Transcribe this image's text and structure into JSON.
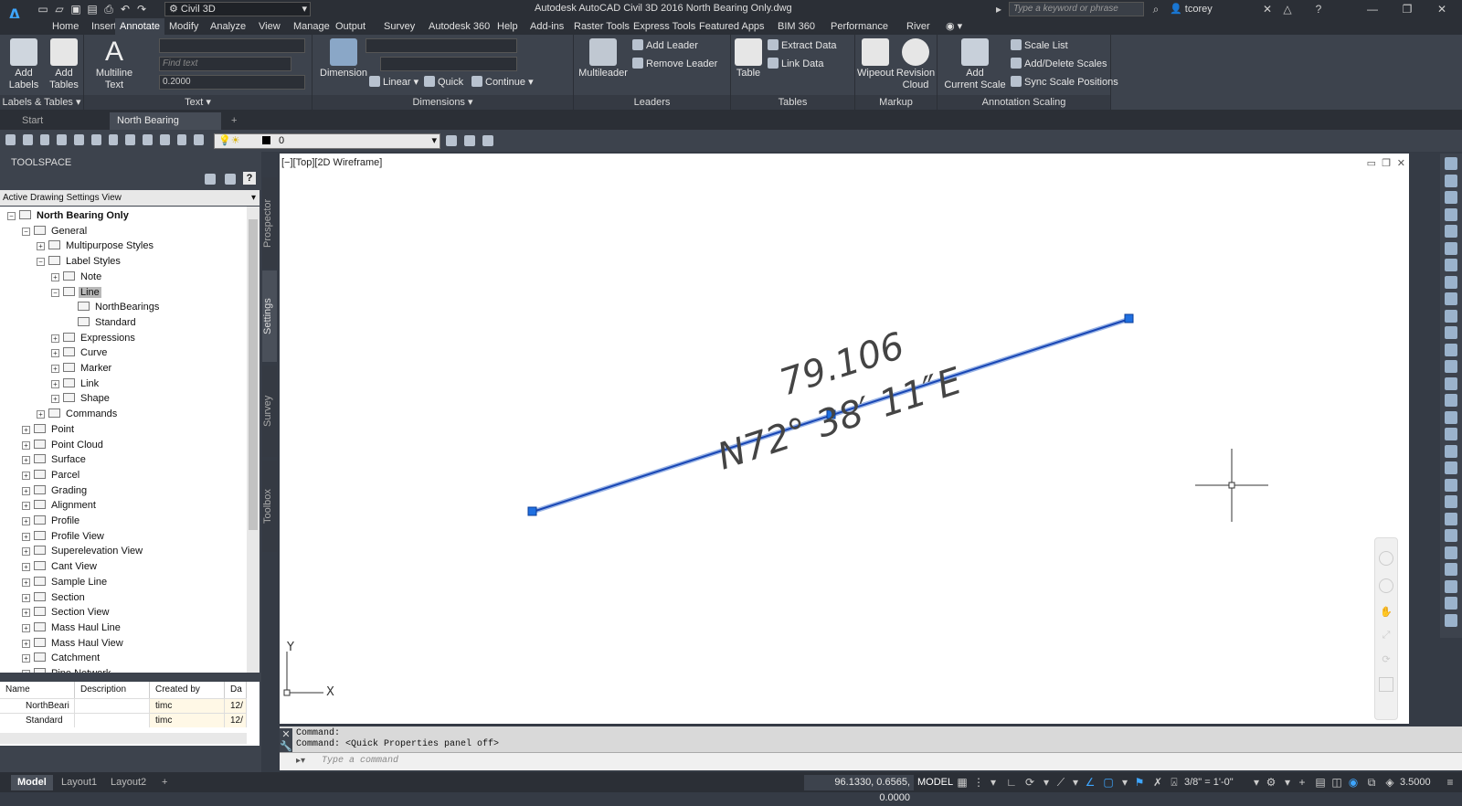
{
  "app": {
    "logo": "A",
    "workspace": "Civil 3D",
    "window_title": "Autodesk AutoCAD Civil 3D 2016    North Bearing Only.dwg",
    "search_placeholder": "Type a keyword or phrase",
    "user": "tcorey"
  },
  "ribbon_tabs": [
    "Home",
    "Insert",
    "Annotate",
    "Modify",
    "Analyze",
    "View",
    "Manage",
    "Output",
    "Survey",
    "Autodesk 360",
    "Help",
    "Add-ins",
    "Raster Tools",
    "Express Tools",
    "Featured Apps",
    "BIM 360",
    "Performance",
    "River"
  ],
  "ribbon": {
    "labels_tables": {
      "title": "Labels & Tables",
      "add_labels": "Add\nLabels",
      "add_tables": "Add\nTables"
    },
    "text": {
      "title": "Text",
      "multiline": "Multiline\nText",
      "find_text": "Find text",
      "height": "0.2000"
    },
    "dimensions": {
      "title": "Dimensions",
      "dimension": "Dimension",
      "linear": "Linear",
      "quick": "Quick",
      "continue": "Continue"
    },
    "leaders": {
      "title": "Leaders",
      "multileader": "Multileader",
      "add_leader": "Add Leader",
      "remove_leader": "Remove Leader"
    },
    "tables": {
      "title": "Tables",
      "table": "Table",
      "extract_data": "Extract Data",
      "link_data": "Link Data"
    },
    "markup": {
      "title": "Markup",
      "wipeout": "Wipeout",
      "revision_cloud": "Revision\nCloud"
    },
    "annotation_scaling": {
      "title": "Annotation Scaling",
      "add_current_scale": "Add\nCurrent Scale",
      "scale_list": "Scale List",
      "add_delete_scales": "Add/Delete Scales",
      "sync_scale_positions": "Sync Scale Positions"
    }
  },
  "doc_tabs": {
    "start": "Start",
    "active": "North Bearing Only*"
  },
  "layer": {
    "current": "0"
  },
  "toolspace": {
    "title": "TOOLSPACE",
    "view": "Active Drawing Settings View",
    "vtabs": [
      "Prospector",
      "Settings",
      "Survey",
      "Toolbox"
    ],
    "tree": [
      {
        "label": "North Bearing Only",
        "level": 0,
        "bold": true,
        "exp": "-"
      },
      {
        "label": "General",
        "level": 1,
        "exp": "-"
      },
      {
        "label": "Multipurpose Styles",
        "level": 2,
        "exp": "+"
      },
      {
        "label": "Label Styles",
        "level": 2,
        "exp": "-"
      },
      {
        "label": "Note",
        "level": 3,
        "exp": "+"
      },
      {
        "label": "Line",
        "level": 3,
        "exp": "-",
        "selected": true
      },
      {
        "label": "NorthBearings",
        "level": 5,
        "exp": ""
      },
      {
        "label": "Standard",
        "level": 5,
        "exp": ""
      },
      {
        "label": "Expressions",
        "level": 4,
        "exp": "+"
      },
      {
        "label": "Curve",
        "level": 3,
        "exp": "+"
      },
      {
        "label": "Marker",
        "level": 3,
        "exp": "+"
      },
      {
        "label": "Link",
        "level": 3,
        "exp": "+"
      },
      {
        "label": "Shape",
        "level": 3,
        "exp": "+"
      },
      {
        "label": "Commands",
        "level": 2,
        "exp": "+"
      },
      {
        "label": "Point",
        "level": 1,
        "exp": "+"
      },
      {
        "label": "Point Cloud",
        "level": 1,
        "exp": "+"
      },
      {
        "label": "Surface",
        "level": 1,
        "exp": "+"
      },
      {
        "label": "Parcel",
        "level": 1,
        "exp": "+"
      },
      {
        "label": "Grading",
        "level": 1,
        "exp": "+"
      },
      {
        "label": "Alignment",
        "level": 1,
        "exp": "+"
      },
      {
        "label": "Profile",
        "level": 1,
        "exp": "+"
      },
      {
        "label": "Profile View",
        "level": 1,
        "exp": "+"
      },
      {
        "label": "Superelevation View",
        "level": 1,
        "exp": "+"
      },
      {
        "label": "Cant View",
        "level": 1,
        "exp": "+"
      },
      {
        "label": "Sample Line",
        "level": 1,
        "exp": "+"
      },
      {
        "label": "Section",
        "level": 1,
        "exp": "+"
      },
      {
        "label": "Section View",
        "level": 1,
        "exp": "+"
      },
      {
        "label": "Mass Haul Line",
        "level": 1,
        "exp": "+"
      },
      {
        "label": "Mass Haul View",
        "level": 1,
        "exp": "+"
      },
      {
        "label": "Catchment",
        "level": 1,
        "exp": "+"
      },
      {
        "label": "Pipe Network",
        "level": 1,
        "exp": "+"
      }
    ],
    "grid": {
      "headers": [
        "Name",
        "Description",
        "Created by",
        "Da"
      ],
      "rows": [
        [
          "NorthBeari",
          "",
          "timc",
          "12/"
        ],
        [
          "Standard",
          "",
          "timc",
          "12/"
        ]
      ]
    }
  },
  "drawing": {
    "view_label": "[−][Top][2D Wireframe]",
    "distance": "79.106",
    "bearing": "N72° 38′ 11″E",
    "line_color": "#1846b4",
    "axis_x": "X",
    "axis_y": "Y"
  },
  "command": {
    "history": [
      "Command:",
      "Command: <Quick Properties panel off>"
    ],
    "placeholder": "Type a command"
  },
  "status": {
    "tabs": [
      "Model",
      "Layout1",
      "Layout2"
    ],
    "coords": "96.1330, 0.6565, 0.0000",
    "model": "MODEL",
    "scale": "3/8\" = 1'-0\"",
    "annotation_value": "3.5000"
  }
}
